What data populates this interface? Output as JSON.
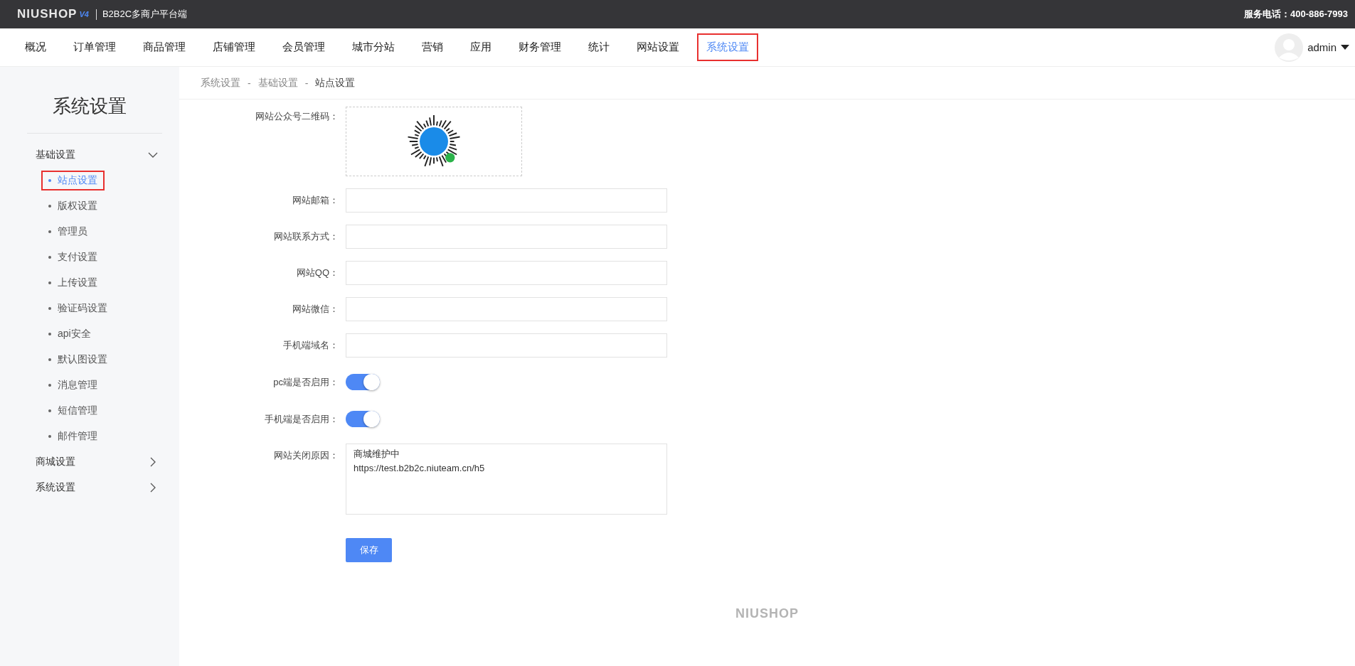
{
  "header": {
    "logo": "NIUSHOP",
    "logo_version": "V4",
    "platform": "B2B2C多商户平台端",
    "service": "服务电话：400-886-7993"
  },
  "nav": [
    {
      "label": "概况",
      "selected": false,
      "highlighted": false
    },
    {
      "label": "订单管理",
      "selected": false,
      "highlighted": false
    },
    {
      "label": "商品管理",
      "selected": false,
      "highlighted": false
    },
    {
      "label": "店铺管理",
      "selected": false,
      "highlighted": false
    },
    {
      "label": "会员管理",
      "selected": false,
      "highlighted": false
    },
    {
      "label": "城市分站",
      "selected": false,
      "highlighted": false
    },
    {
      "label": "营销",
      "selected": false,
      "highlighted": false
    },
    {
      "label": "应用",
      "selected": false,
      "highlighted": false
    },
    {
      "label": "财务管理",
      "selected": false,
      "highlighted": false
    },
    {
      "label": "统计",
      "selected": false,
      "highlighted": false
    },
    {
      "label": "网站设置",
      "selected": false,
      "highlighted": false
    },
    {
      "label": "系统设置",
      "selected": true,
      "highlighted": true
    }
  ],
  "user": {
    "name": "admin"
  },
  "sidebar": {
    "title": "系统设置",
    "groups": [
      {
        "label": "基础设置",
        "expanded": true,
        "children": [
          {
            "label": "站点设置",
            "selected": true,
            "highlighted": true
          },
          {
            "label": "版权设置",
            "selected": false,
            "highlighted": false
          },
          {
            "label": "管理员",
            "selected": false,
            "highlighted": false
          },
          {
            "label": "支付设置",
            "selected": false,
            "highlighted": false
          },
          {
            "label": "上传设置",
            "selected": false,
            "highlighted": false
          },
          {
            "label": "验证码设置",
            "selected": false,
            "highlighted": false
          },
          {
            "label": "api安全",
            "selected": false,
            "highlighted": false
          },
          {
            "label": "默认图设置",
            "selected": false,
            "highlighted": false
          },
          {
            "label": "消息管理",
            "selected": false,
            "highlighted": false
          },
          {
            "label": "短信管理",
            "selected": false,
            "highlighted": false
          },
          {
            "label": "邮件管理",
            "selected": false,
            "highlighted": false
          }
        ]
      },
      {
        "label": "商城设置",
        "expanded": false
      },
      {
        "label": "系统设置",
        "expanded": false
      }
    ]
  },
  "breadcrumb": [
    {
      "kind": "link",
      "text": "系统设置"
    },
    {
      "kind": "separator",
      "text": "-"
    },
    {
      "kind": "link",
      "text": "基础设置"
    },
    {
      "kind": "separator",
      "text": "-"
    },
    {
      "kind": "current",
      "text": "站点设置"
    }
  ],
  "form": [
    {
      "kind": "image",
      "label": "网站公众号二维码："
    },
    {
      "kind": "text",
      "label": "网站邮箱："
    },
    {
      "kind": "text",
      "label": "网站联系方式："
    },
    {
      "kind": "text",
      "label": "网站QQ："
    },
    {
      "kind": "text",
      "label": "网站微信："
    },
    {
      "kind": "text",
      "label": "手机端域名："
    },
    {
      "kind": "toggle",
      "label": "pc端是否启用：",
      "on": true
    },
    {
      "kind": "toggle",
      "label": "手机端是否启用：",
      "on": true
    },
    {
      "kind": "textarea",
      "label": "网站关闭原因：",
      "value": "商城维护中\nhttps://test.b2b2c.niuteam.cn/h5"
    }
  ],
  "save_button": "保存",
  "footer_logo": "NIUSHOP"
}
